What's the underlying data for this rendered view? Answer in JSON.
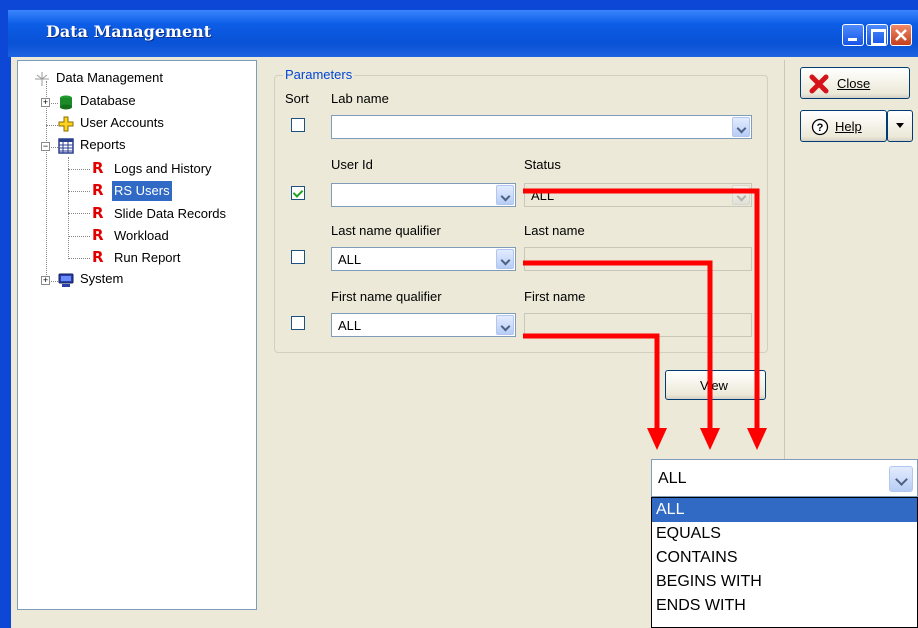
{
  "window": {
    "title": "Data Management"
  },
  "tree": {
    "items": [
      {
        "label": "Data Management",
        "icon": "tree-root-icon"
      },
      {
        "label": "Database",
        "icon": "database-icon"
      },
      {
        "label": "User Accounts",
        "icon": "user-accounts-icon"
      },
      {
        "label": "Reports",
        "icon": "reports-icon"
      },
      {
        "label": "Logs and History",
        "icon": "report-r-icon"
      },
      {
        "label": "RS Users",
        "icon": "report-r-icon",
        "selected": true
      },
      {
        "label": "Slide Data Records",
        "icon": "report-r-icon"
      },
      {
        "label": "Workload",
        "icon": "report-r-icon"
      },
      {
        "label": "Run Report",
        "icon": "report-r-icon"
      },
      {
        "label": "System",
        "icon": "system-icon"
      }
    ]
  },
  "parameters": {
    "title": "Parameters",
    "sort_label": "Sort",
    "lab_name": {
      "label": "Lab name",
      "value": "",
      "sort_checked": false
    },
    "user_id": {
      "label": "User Id",
      "value": "",
      "sort_checked": true
    },
    "status": {
      "label": "Status",
      "value": "ALL"
    },
    "last_name_qualifier": {
      "label": "Last name qualifier",
      "value": "ALL",
      "sort_checked": false
    },
    "last_name": {
      "label": "Last name",
      "value": ""
    },
    "first_name_qualifier": {
      "label": "First name qualifier",
      "value": "ALL",
      "sort_checked": false
    },
    "first_name": {
      "label": "First name",
      "value": ""
    },
    "view_button": "View"
  },
  "side_buttons": {
    "close": "Close",
    "help": "Help"
  },
  "dropdown": {
    "value": "ALL",
    "options": [
      "ALL",
      "EQUALS",
      "CONTAINS",
      "BEGINS WITH",
      "ENDS WITH"
    ],
    "selected_index": 0
  },
  "colors": {
    "title_bar": "#0852d6",
    "selection": "#316ac5",
    "callout_arrow": "#ff0000",
    "group_title": "#0046d5"
  }
}
